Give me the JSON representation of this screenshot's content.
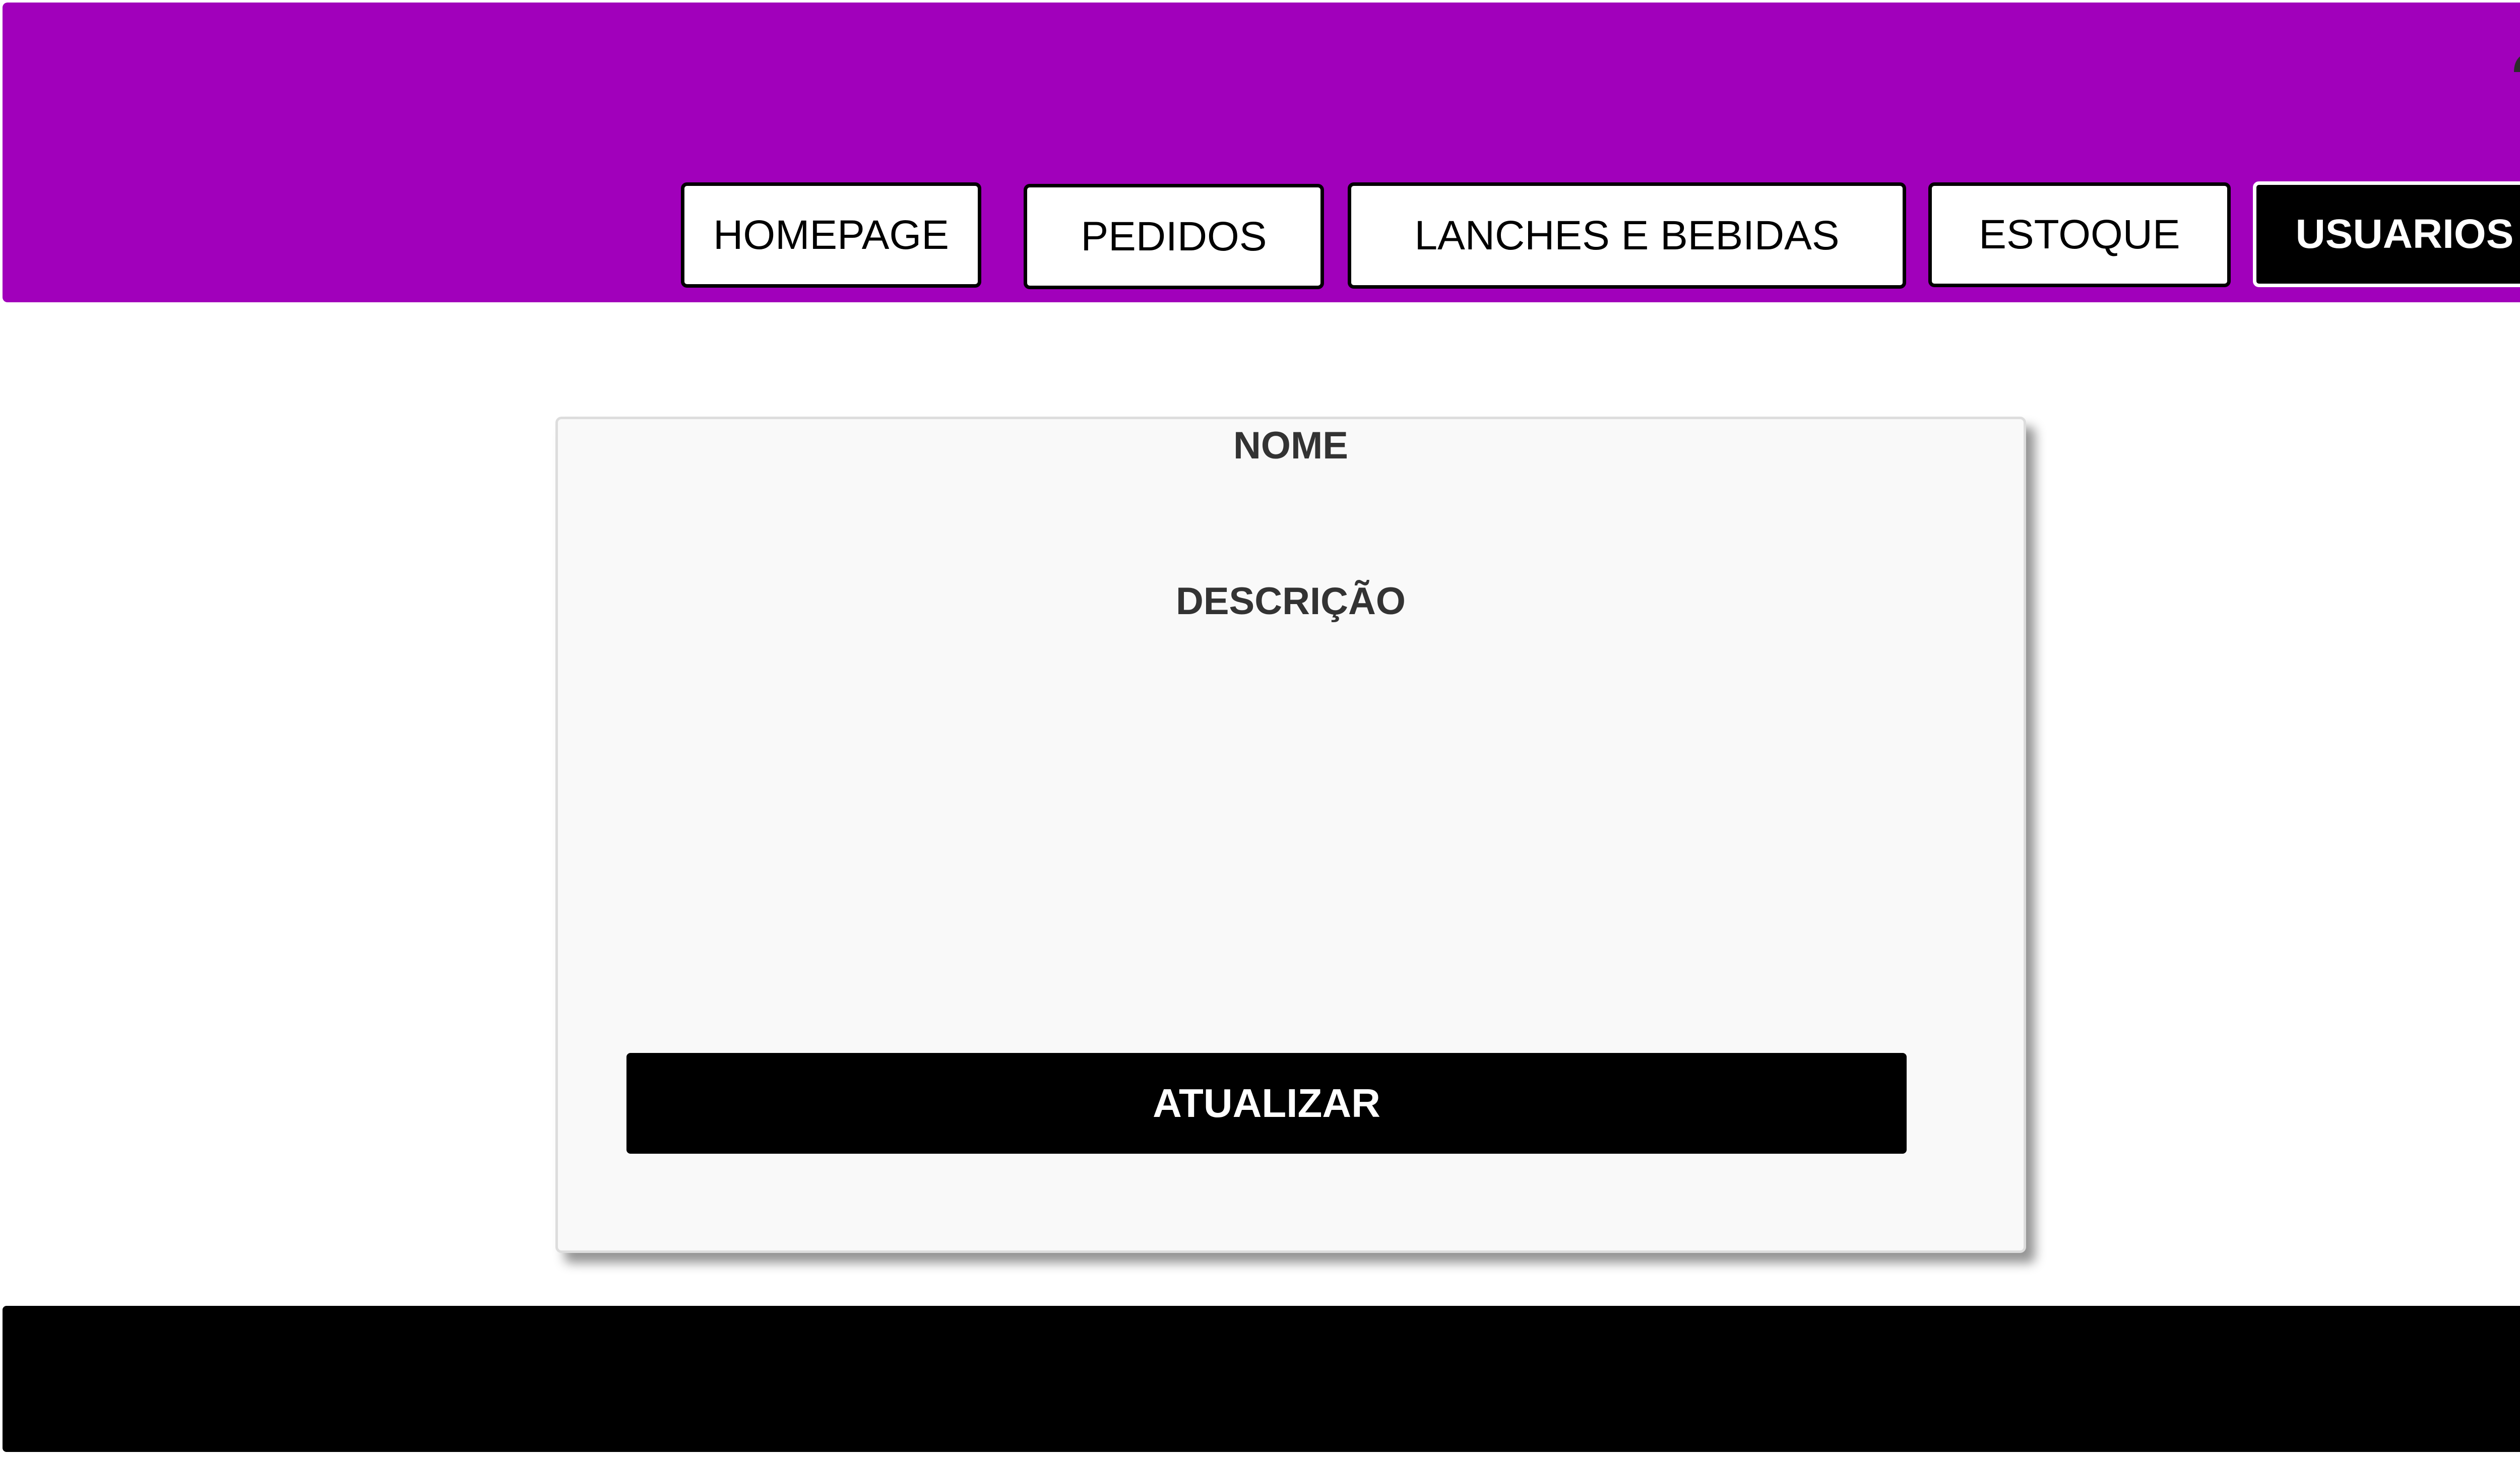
{
  "colors": {
    "header_background": "#a100bb",
    "card_background": "#f9f9f9",
    "submit_background": "#000000",
    "footer_background": "#000000",
    "nav_active_background": "#000000",
    "nav_background": "#ffffff"
  },
  "header": {
    "user_icon": "user-account-icon",
    "nav": [
      {
        "label": "HOMEPAGE",
        "active": false
      },
      {
        "label": "PEDIDOS",
        "active": false
      },
      {
        "label": "LANCHES E BEBIDAS",
        "active": false
      },
      {
        "label": "ESTOQUE",
        "active": false
      },
      {
        "label": "USUARIOS",
        "active": true
      }
    ]
  },
  "form": {
    "name_label": "NOME",
    "description_label": "DESCRIÇÃO",
    "submit_label": "ATUALIZAR"
  }
}
